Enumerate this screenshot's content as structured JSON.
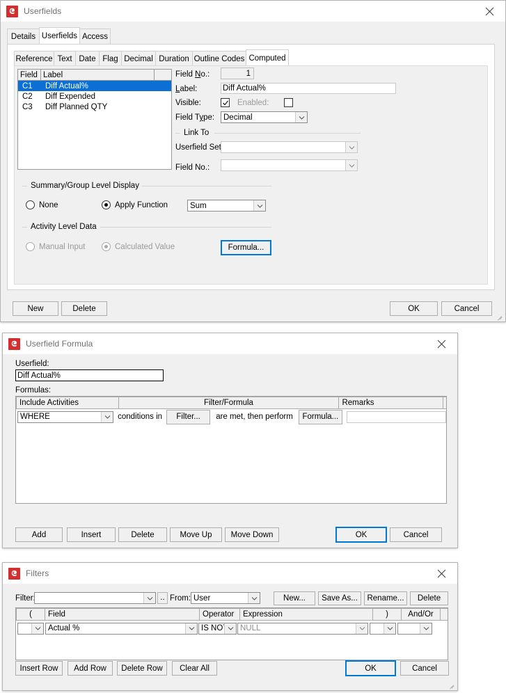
{
  "userfields_window": {
    "title": "Userfields",
    "close_label": "✕",
    "outer_tabs": [
      {
        "label": "Details",
        "selected": false
      },
      {
        "label": "Userfields",
        "selected": true
      },
      {
        "label": "Access",
        "selected": false
      }
    ],
    "inner_tabs": [
      {
        "label": "Reference",
        "selected": false
      },
      {
        "label": "Text",
        "selected": false
      },
      {
        "label": "Date",
        "selected": false
      },
      {
        "label": "Flag",
        "selected": false
      },
      {
        "label": "Decimal",
        "selected": false
      },
      {
        "label": "Duration",
        "selected": false
      },
      {
        "label": "Outline Codes",
        "selected": false
      },
      {
        "label": "Computed",
        "selected": true
      }
    ],
    "list": {
      "columns": [
        "Field",
        "Label",
        ""
      ],
      "rows": [
        {
          "field": "C1",
          "label": "Diff Actual%",
          "selected": true
        },
        {
          "field": "C2",
          "label": "Diff Expended",
          "selected": false
        },
        {
          "field": "C3",
          "label": "Diff Planned QTY",
          "selected": false
        }
      ]
    },
    "form": {
      "field_no_label": "Field No.:",
      "field_no_value": "1",
      "label_label": "Label:",
      "label_value": "Diff Actual%",
      "visible_label": "Visible:",
      "visible_checked": true,
      "enabled_label": "Enabled:",
      "enabled_checked": false,
      "field_type_label": "Field Type:",
      "field_type_value": "Decimal"
    },
    "link_to": {
      "caption": "Link To",
      "userfield_set_label": "Userfield Set:",
      "userfield_set_value": "",
      "field_no_label": "Field No.:",
      "field_no_value": ""
    },
    "summary_group": {
      "caption": "Summary/Group Level Display",
      "none_label": "None",
      "none_selected": false,
      "apply_function_label": "Apply Function",
      "apply_function_selected": true,
      "function_value": "Sum"
    },
    "activity_level": {
      "caption": "Activity Level Data",
      "manual_input_label": "Manual Input",
      "manual_input_selected": false,
      "calculated_value_label": "Calculated Value",
      "calculated_value_selected": true,
      "formula_button": "Formula..."
    },
    "buttons": {
      "new": "New",
      "delete": "Delete",
      "ok": "OK",
      "cancel": "Cancel"
    }
  },
  "formula_window": {
    "title": "Userfield Formula",
    "close_label": "✕",
    "userfield_label": "Userfield:",
    "userfield_value": "Diff Actual%",
    "formulas_label": "Formulas:",
    "columns": [
      "Include Activities",
      "Filter/Formula",
      "Remarks"
    ],
    "row": {
      "include_activities": "WHERE",
      "text_before": "conditions in",
      "filter_button": "Filter...",
      "text_middle": "are met, then perform",
      "formula_button": "Formula...",
      "remarks_value": ""
    },
    "buttons": {
      "add": "Add",
      "insert": "Insert",
      "delete": "Delete",
      "move_up": "Move Up",
      "move_down": "Move Down",
      "ok": "OK",
      "cancel": "Cancel"
    }
  },
  "filters_window": {
    "title": "Filters",
    "close_label": "✕",
    "filter_label": "Filter:",
    "filter_value": "",
    "browse_button": "..",
    "from_label": "From:",
    "from_value": "User",
    "buttons": {
      "new": "New...",
      "save_as": "Save As...",
      "rename": "Rename...",
      "delete": "Delete",
      "insert_row": "Insert Row",
      "add_row": "Add Row",
      "delete_row": "Delete Row",
      "clear_all": "Clear All",
      "ok": "OK",
      "cancel": "Cancel"
    },
    "columns": [
      "(",
      "Field",
      "Operator",
      "Expression",
      ")",
      "And/Or"
    ],
    "row": {
      "open_paren": "",
      "field": "Actual %",
      "operator": "IS NOT",
      "expression": "NULL",
      "close_paren": "",
      "and_or": ""
    }
  },
  "colors": {
    "accent": "#0078d7",
    "selection": "#0b6fd4",
    "app_icon": "#d32f2f",
    "window_bg": "#f0f0f0"
  }
}
